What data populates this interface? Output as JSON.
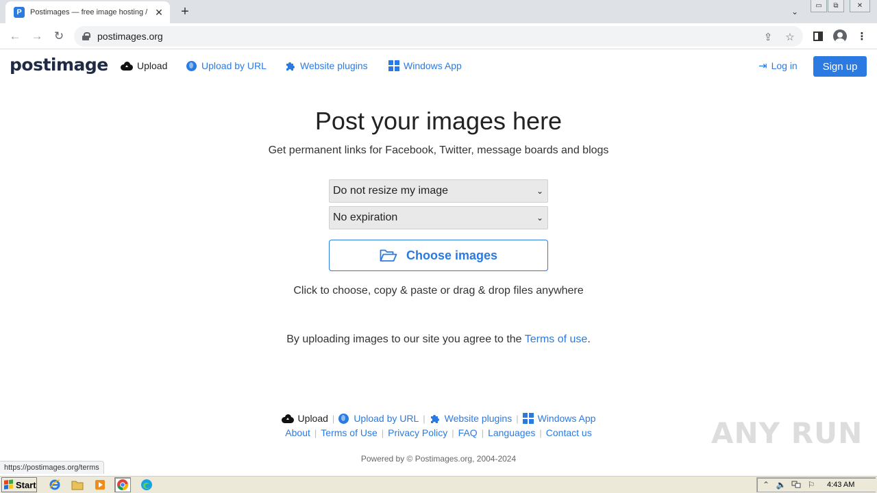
{
  "browser": {
    "tab_title": "Postimages — free image hosting / im",
    "url": "postimages.org",
    "status_url": "https://postimages.org/terms"
  },
  "nav": {
    "logo": "postimage",
    "upload": "Upload",
    "upload_by_url": "Upload by URL",
    "website_plugins": "Website plugins",
    "windows_app": "Windows App",
    "login": "Log in",
    "signup": "Sign up"
  },
  "main": {
    "title": "Post your images here",
    "subtitle": "Get permanent links for Facebook, Twitter, message boards and blogs",
    "resize_select": "Do not resize my image",
    "expiration_select": "No expiration",
    "choose_button": "Choose images",
    "hint": "Click to choose, copy & paste or drag & drop files anywhere",
    "agree_text": "By uploading images to our site you agree to the",
    "terms_link": "Terms of use",
    "agree_end": "."
  },
  "footer": {
    "row1": [
      "Upload",
      "Upload by URL",
      "Website plugins",
      "Windows App"
    ],
    "row2": [
      "About",
      "Terms of Use",
      "Privacy Policy",
      "FAQ",
      "Languages",
      "Contact us"
    ],
    "powered": "Powered by © Postimages.org, 2004-2024"
  },
  "watermark": "ANY RUN",
  "taskbar": {
    "start": "Start",
    "clock": "4:43 AM"
  },
  "colors": {
    "accent": "#2a7ae2",
    "text": "#222222"
  }
}
